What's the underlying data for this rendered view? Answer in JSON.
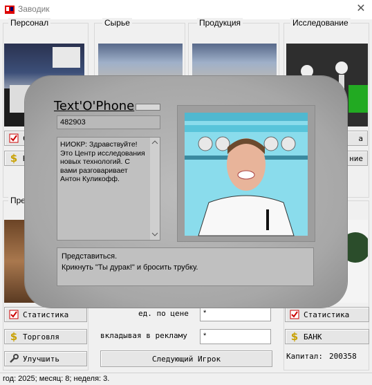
{
  "window": {
    "title": "Заводик",
    "close": "✕"
  },
  "groups": {
    "personnel": "Персонал",
    "raw": "Сырье",
    "products": "Продукция",
    "research": "Исследование",
    "left_bottom_partial": "Пре"
  },
  "left_buttons": {
    "top1": "С",
    "top2": "Н",
    "stats": "Статистика",
    "trade": "Торговля",
    "improve": "Улучшить"
  },
  "right_buttons": {
    "top1_partial": "а",
    "top2_partial": "ние",
    "stats": "Статистика",
    "bank": "БАНК",
    "capital_label": "Капитал:",
    "capital_value": "200358"
  },
  "center": {
    "price_label": "ед. по цене",
    "price_value": "*",
    "ads_label": "вкладывая в рекламу",
    "ads_value": "*",
    "next_player": "Следующий Игрок"
  },
  "status_bar": "год: 2025; месяц: 8; неделя: 3.",
  "dialog": {
    "title": "Text'O'Phone",
    "number": "482903",
    "message": "НИОКР: Здравствуйте! Это Центр исследования новых технологий. С вами разговаривает Антон Куликофф.",
    "options": [
      "Представиться.",
      "Крикнуть \"Ты дурак!\" и бросить трубку."
    ]
  },
  "icons": [
    "app-icon",
    "stats-icon",
    "dollar-icon",
    "wrench-icon",
    "close-icon"
  ]
}
